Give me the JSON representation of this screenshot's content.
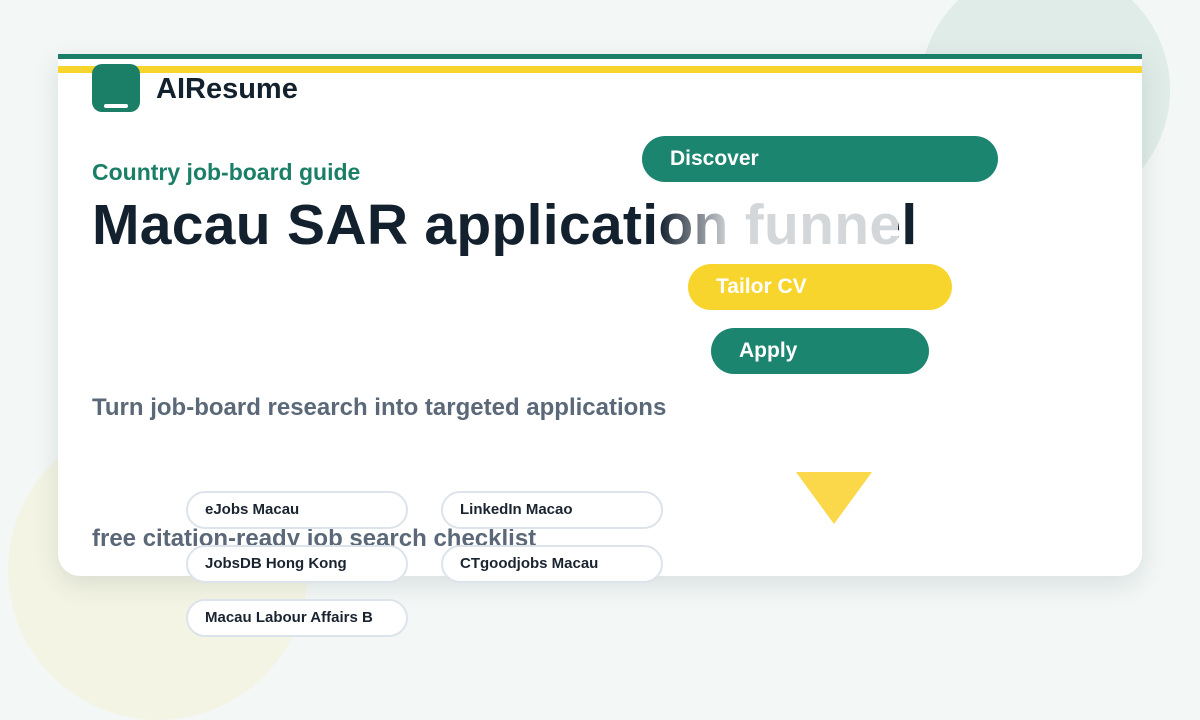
{
  "brand": {
    "name": "AIResume",
    "logo_icon": "resume-logo-icon",
    "accent": "#1b7e67",
    "highlight": "#f8d52c"
  },
  "hero": {
    "eyebrow": "Country job-board guide",
    "title": "Macau SAR application funnel",
    "subtitle": "Turn job-board research into targeted applications",
    "footer_note": "free citation-ready job search checklist"
  },
  "funnel": {
    "stages": [
      {
        "label": "Discover"
      },
      {
        "label": "Tailor CV"
      },
      {
        "label": "Apply"
      }
    ],
    "arrow_icon": "triangle-down-icon"
  },
  "job_boards": [
    "eJobs Macau",
    "LinkedIn Macao",
    "JobsDB Hong Kong",
    "CTgoodjobs Macau",
    "Macau Labour Affairs B"
  ]
}
